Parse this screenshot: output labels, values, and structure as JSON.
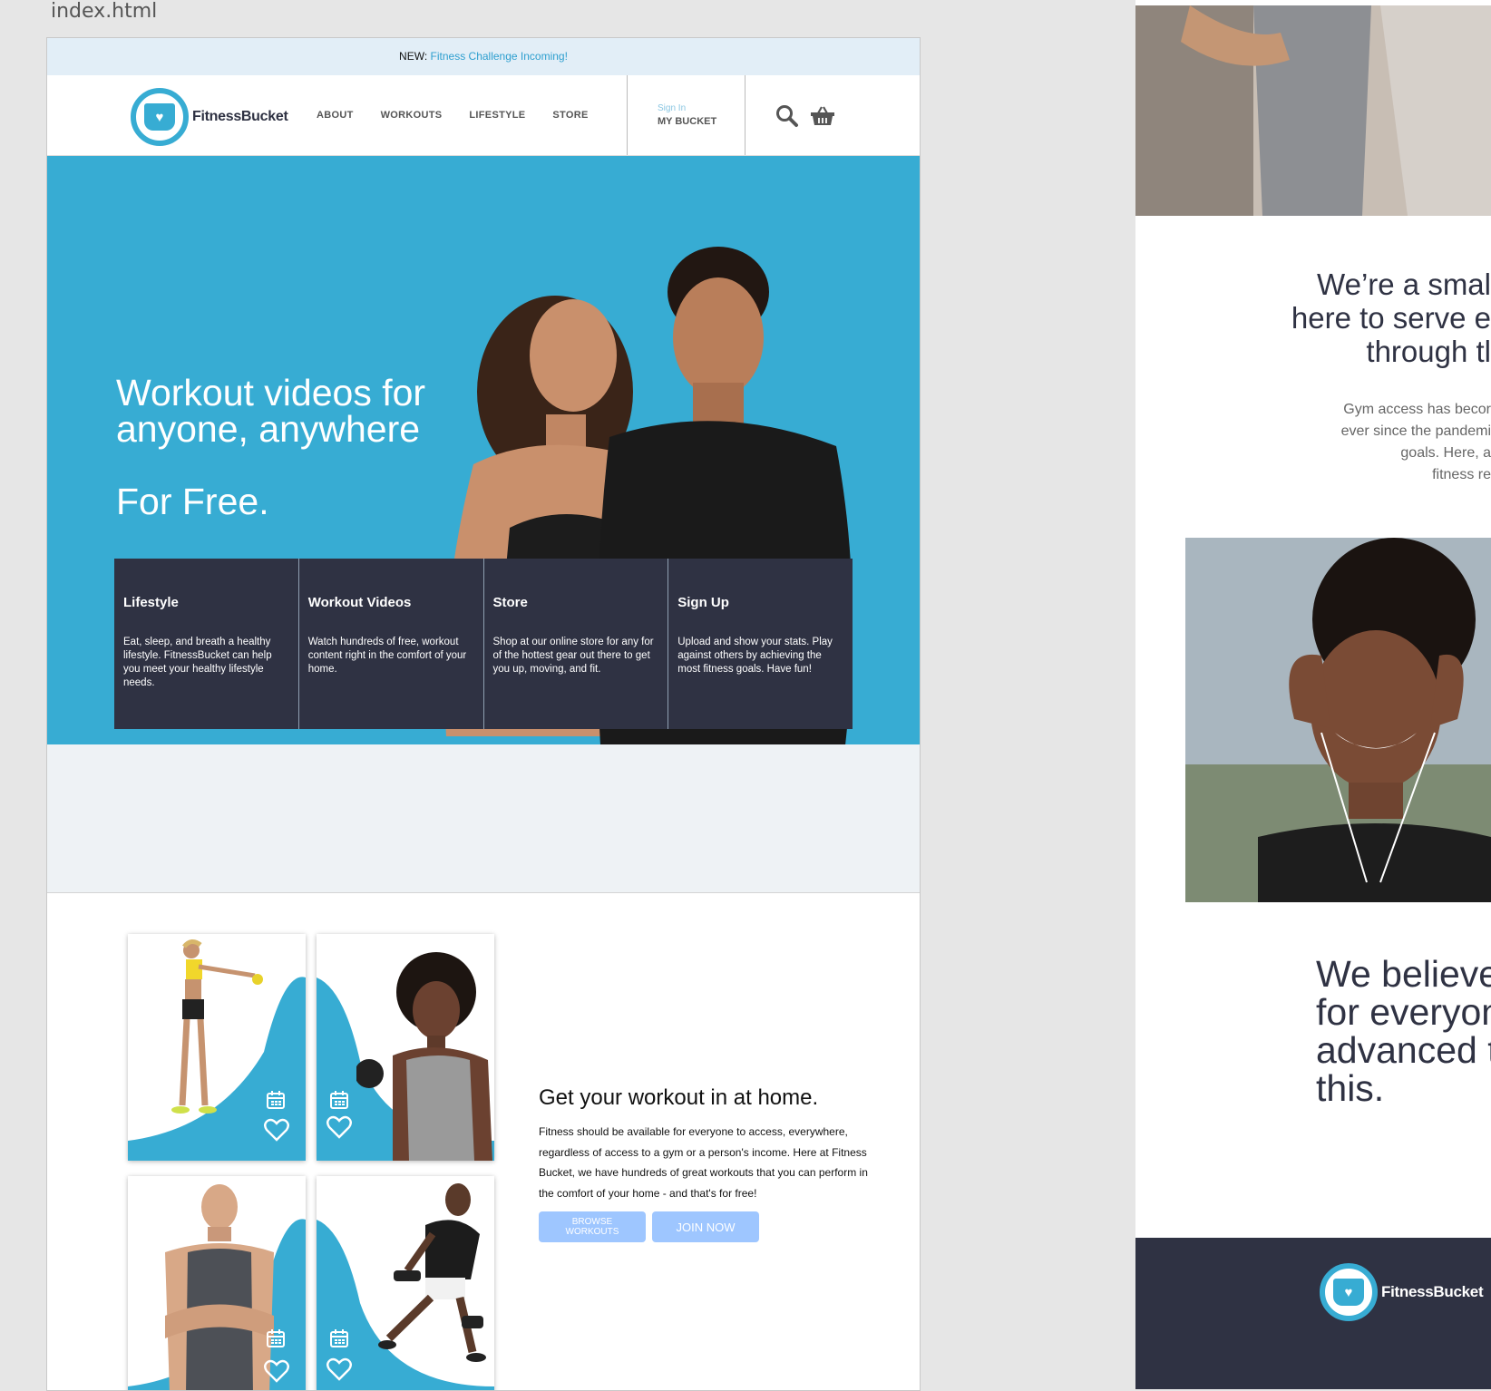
{
  "canvas": {
    "filename": "index.html"
  },
  "announcement": {
    "prefix": "NEW:",
    "link": "Fitness Challenge Incoming!"
  },
  "brand": {
    "name": "FitnessBucket",
    "accent": "#37acd3",
    "dark": "#2f3243",
    "button": "#9ec6ff"
  },
  "nav": {
    "links": [
      "ABOUT",
      "WORKOUTS",
      "LIFESTYLE",
      "STORE"
    ],
    "sign_in": "Sign In",
    "my_bucket": "MY BUCKET",
    "icons": [
      "search-icon",
      "basket-icon"
    ]
  },
  "hero": {
    "headline": "Workout videos for anyone, anywhere",
    "sub": "For Free."
  },
  "features": [
    {
      "title": "Lifestyle",
      "text": "Eat, sleep, and breath a healthy lifestyle. FitnessBucket can help you meet your healthy lifestyle needs."
    },
    {
      "title": "Workout Videos",
      "text": "Watch hundreds of free, workout content right in the comfort of your home."
    },
    {
      "title": "Store",
      "text": "Shop at our online store for any for of the hottest gear out there to get you up, moving, and fit."
    },
    {
      "title": "Sign Up",
      "text": "Upload and show your stats. Play against others by achieving the most fitness goals. Have fun!"
    }
  ],
  "workouts": {
    "heading": "Get your workout in at home.",
    "body": "Fitness should be available for everyone to access, everywhere, regardless of access to a gym or a person's income. Here at Fitness Bucket, we have hundreds of great workouts that you can perform in the comfort of your home - and that's for free!",
    "browse_label": "BROWSE WORKOUTS",
    "join_label": "JOIN NOW",
    "card_icons": [
      "calendar-icon",
      "heart-icon"
    ]
  },
  "right": {
    "about_heading_lines": [
      "We’re a smal",
      "here to serve e",
      "through tl"
    ],
    "about_body_lines": [
      "Gym access has becor",
      "ever since the pandemi",
      "goals. Here, a",
      "fitness re"
    ],
    "believe_lines": [
      "We believe",
      "for everyon",
      "advanced t",
      "this."
    ],
    "footer_brand": "FitnessBucket"
  }
}
